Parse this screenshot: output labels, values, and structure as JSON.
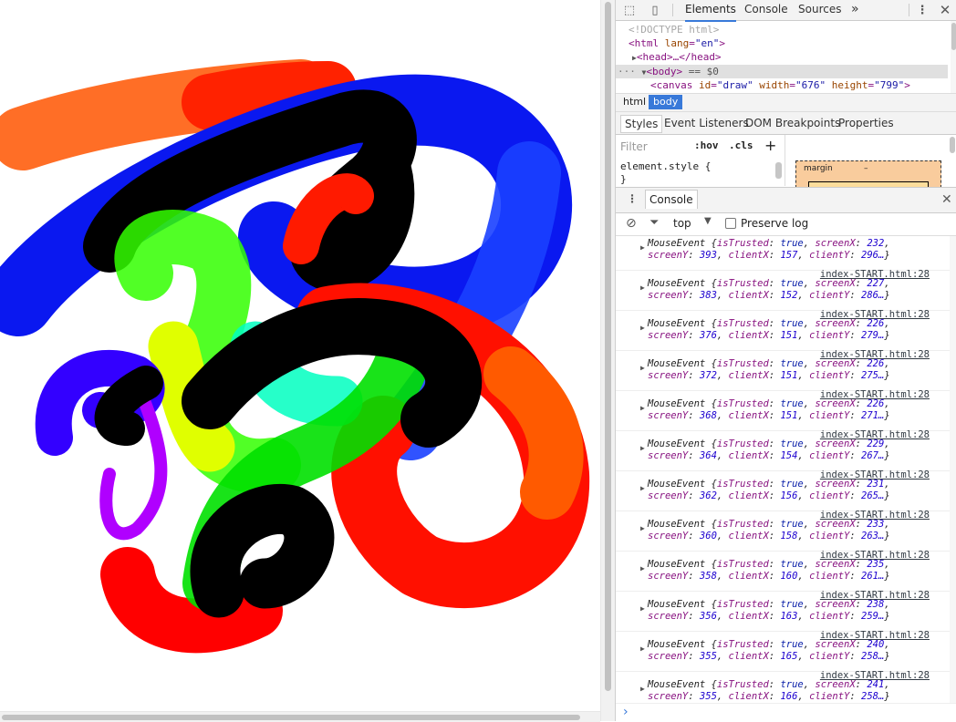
{
  "devtools": {
    "tabs": [
      "Elements",
      "Console",
      "Sources"
    ],
    "more_tabs": "»",
    "dom": {
      "doctype": "<!DOCTYPE html>",
      "html_open_tag": "html",
      "html_lang_attr": "lang",
      "html_lang_value": "\"en\"",
      "head_tag": "head",
      "head_collapsed": "…</head>",
      "body_tag": "body",
      "body_marker": "== $0",
      "canvas_tag": "canvas",
      "canvas_id_attr": "id",
      "canvas_id_value": "\"draw\"",
      "canvas_width_attr": "width",
      "canvas_width_value": "\"676\"",
      "canvas_height_attr": "height",
      "canvas_height_value": "\"799\""
    },
    "breadcrumbs": [
      "html",
      "body"
    ],
    "styles_tabs": [
      "Styles",
      "Event Listeners",
      "DOM Breakpoints",
      "Properties"
    ],
    "filter_placeholder": "Filter",
    "hov_label": ":hov",
    "cls_label": ".cls",
    "add_rule": "+",
    "element_style": "element.style {",
    "element_style_close": "}",
    "box_model": {
      "margin_label": "margin",
      "margin_value": "–"
    },
    "drawer_tab": "Console",
    "console_toolbar": {
      "context": "top",
      "preserve_log": "Preserve log"
    },
    "console_prompt": "›"
  },
  "console_messages": [
    {
      "source": "",
      "screenX": "232",
      "screenY": "393",
      "clientX": "157",
      "clientY": "296…"
    },
    {
      "source": "index-START.html:28",
      "screenX": "227",
      "screenY": "383",
      "clientX": "152",
      "clientY": "286…"
    },
    {
      "source": "index-START.html:28",
      "screenX": "226",
      "screenY": "376",
      "clientX": "151",
      "clientY": "279…"
    },
    {
      "source": "index-START.html:28",
      "screenX": "226",
      "screenY": "372",
      "clientX": "151",
      "clientY": "275…"
    },
    {
      "source": "index-START.html:28",
      "screenX": "226",
      "screenY": "368",
      "clientX": "151",
      "clientY": "271…"
    },
    {
      "source": "index-START.html:28",
      "screenX": "229",
      "screenY": "364",
      "clientX": "154",
      "clientY": "267…"
    },
    {
      "source": "index-START.html:28",
      "screenX": "231",
      "screenY": "362",
      "clientX": "156",
      "clientY": "265…"
    },
    {
      "source": "index-START.html:28",
      "screenX": "233",
      "screenY": "360",
      "clientX": "158",
      "clientY": "263…"
    },
    {
      "source": "index-START.html:28",
      "screenX": "235",
      "screenY": "358",
      "clientX": "160",
      "clientY": "261…"
    },
    {
      "source": "index-START.html:28",
      "screenX": "238",
      "screenY": "356",
      "clientX": "163",
      "clientY": "259…"
    },
    {
      "source": "index-START.html:28",
      "screenX": "240",
      "screenY": "355",
      "clientX": "165",
      "clientY": "258…"
    },
    {
      "source": "index-START.html:28",
      "screenX": "241",
      "screenY": "355",
      "clientX": "166",
      "clientY": "258…"
    }
  ],
  "event_words": {
    "name": "MouseEvent",
    "isTrusted": "isTrusted",
    "trueval": "true",
    "sx": "screenX",
    "sy": "screenY",
    "cx": "clientX",
    "cy": "clientY"
  }
}
